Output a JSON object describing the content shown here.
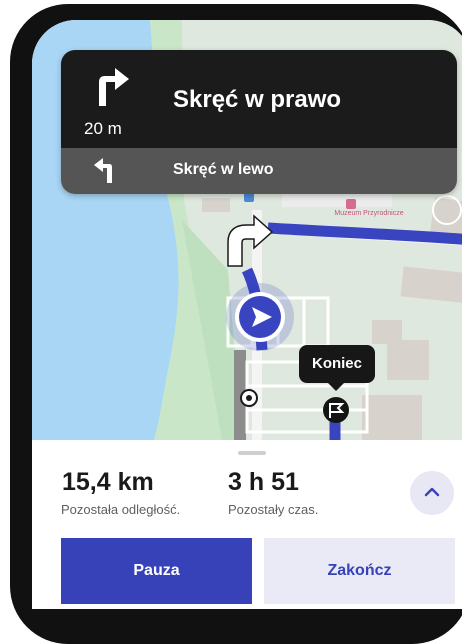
{
  "navigation": {
    "instruction": "Skręć w prawo",
    "distance": "20 m",
    "next_instruction": "Skręć w lewo",
    "main_icon": "turn-right-icon",
    "next_icon": "turn-left-icon"
  },
  "map": {
    "poi_label": "Muzeum Przyrodnicze",
    "destination_label": "Koniec",
    "route_color": "#3944c0",
    "water_color": "#a9d6f5",
    "park_color": "#c9e7c8"
  },
  "summary": {
    "distance_value": "15,4 km",
    "distance_label": "Pozostała odległość.",
    "time_value": "3 h 51",
    "time_label": "Pozostały czas."
  },
  "actions": {
    "pause_label": "Pauza",
    "end_label": "Zakończ"
  },
  "colors": {
    "accent": "#3742b8",
    "card_dark": "#1b1b1b",
    "card_secondary": "#555555"
  }
}
